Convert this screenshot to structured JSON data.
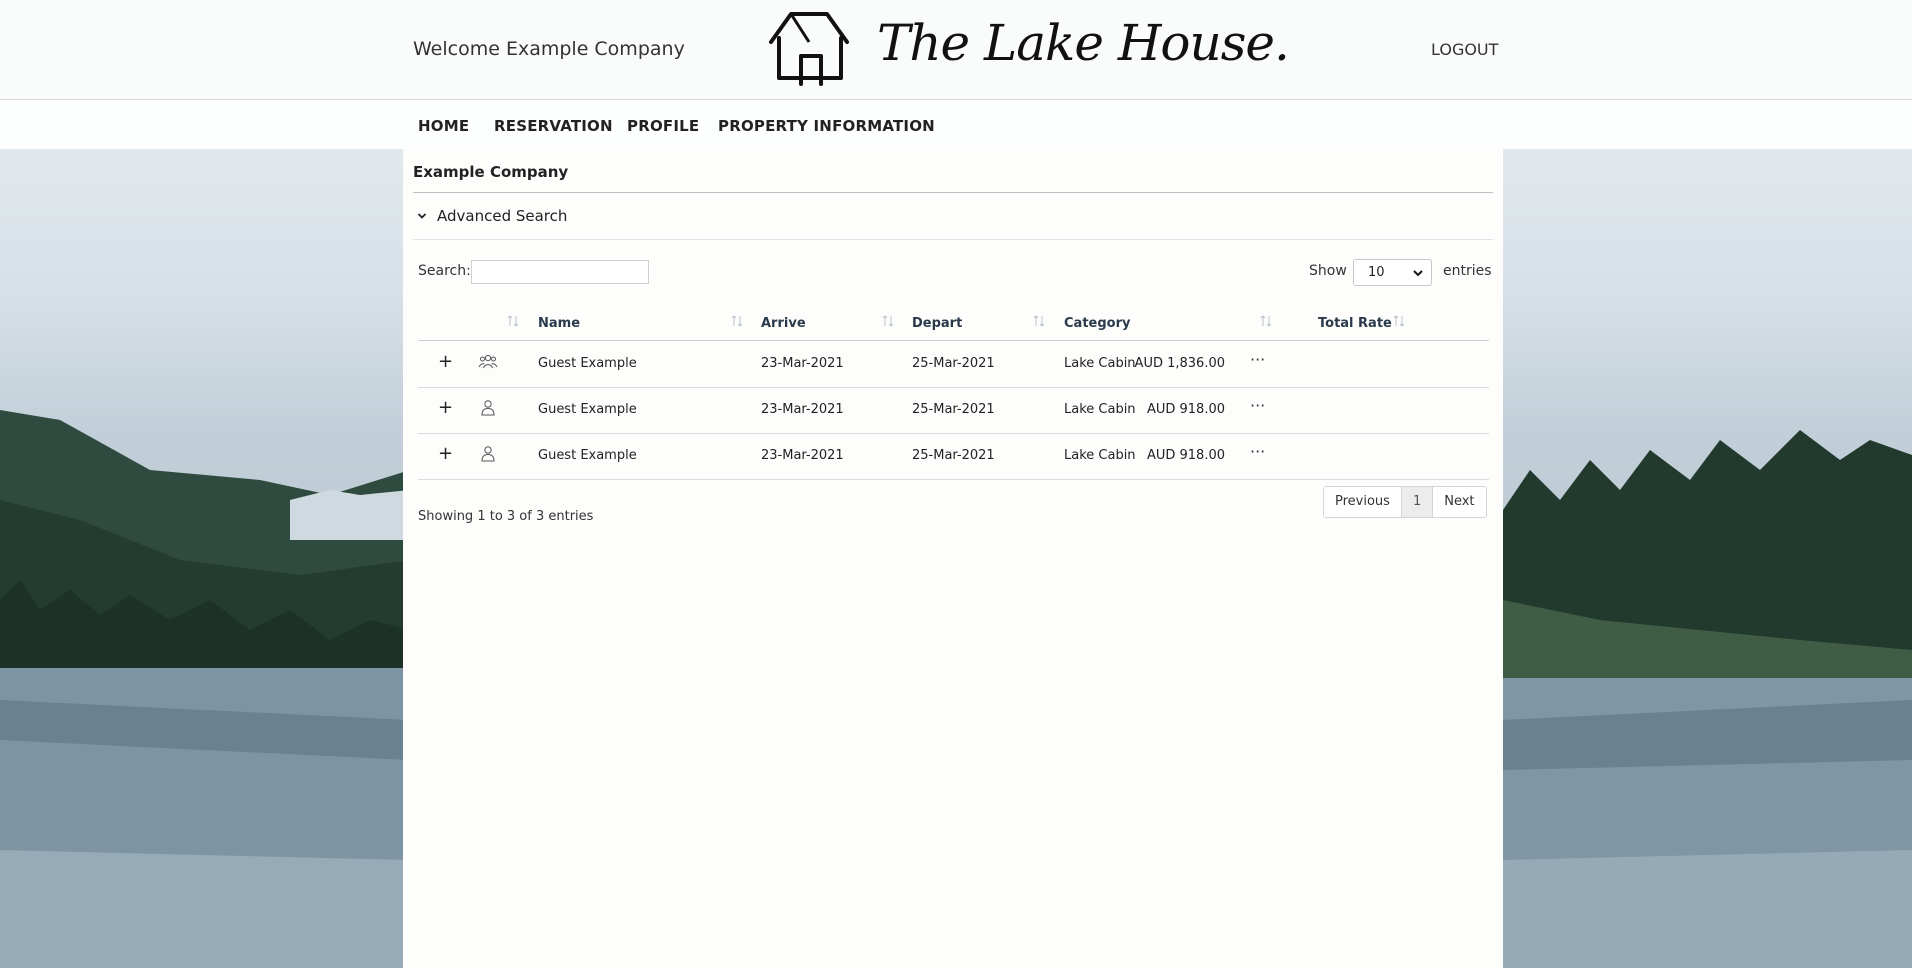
{
  "header": {
    "welcome": "Welcome Example Company",
    "logo_text": "The Lake House.",
    "logout": "LOGOUT"
  },
  "nav": {
    "items": [
      "HOME",
      "RESERVATION",
      "PROFILE",
      "PROPERTY INFORMATION"
    ]
  },
  "main": {
    "company": "Example Company",
    "advanced_search": "Advanced Search",
    "search_label": "Search:",
    "search_value": "",
    "show_label": "Show",
    "show_value": "10",
    "entries_label": "entries"
  },
  "table": {
    "columns": [
      "Name",
      "Arrive",
      "Depart",
      "Category",
      "Total Rate"
    ],
    "rows": [
      {
        "icon": "group-icon",
        "name": "Guest Example",
        "arrive": "23-Mar-2021",
        "depart": "25-Mar-2021",
        "category": "Lake Cabin",
        "rate": "AUD 1,836.00"
      },
      {
        "icon": "person-icon",
        "name": "Guest Example",
        "arrive": "23-Mar-2021",
        "depart": "25-Mar-2021",
        "category": "Lake Cabin",
        "rate": "AUD 918.00"
      },
      {
        "icon": "person-icon",
        "name": "Guest Example",
        "arrive": "23-Mar-2021",
        "depart": "25-Mar-2021",
        "category": "Lake Cabin",
        "rate": "AUD 918.00"
      }
    ],
    "info": "Showing 1 to 3 of 3 entries",
    "pager": {
      "previous": "Previous",
      "current": "1",
      "next": "Next"
    }
  },
  "colors": {
    "panel": "#fdfdfc",
    "header_bg": "#fafbfb",
    "text": "#222222"
  }
}
